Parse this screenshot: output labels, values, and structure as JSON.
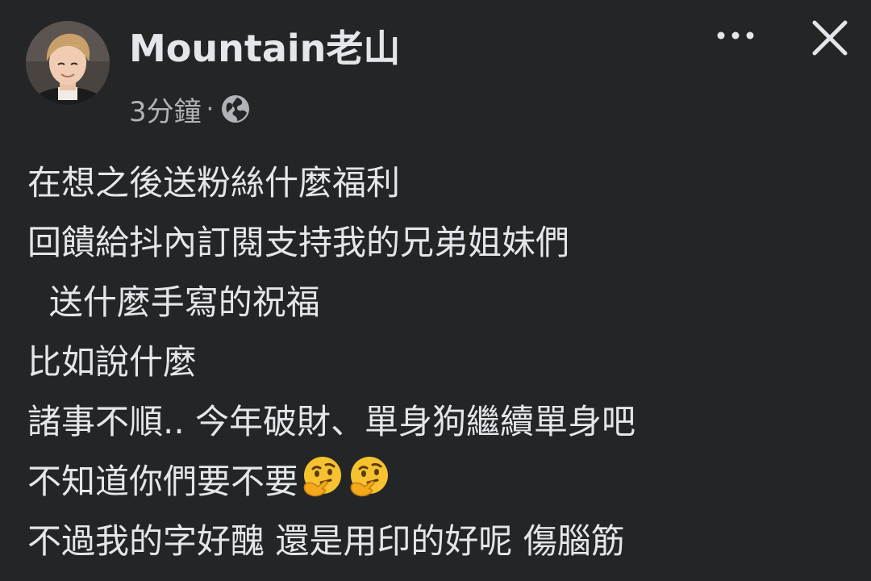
{
  "post": {
    "author_name": "Mountain老山",
    "timestamp": "3分鐘",
    "separator": "·",
    "privacy_icon": "globe-icon",
    "more_icon": "more-dots-icon",
    "close_icon": "close-icon",
    "lines": [
      "在想之後送粉絲什麼福利",
      "回饋給抖內訂閱支持我的兄弟姐妹們",
      "  送什麼手寫的祝福",
      "比如說什麼",
      "諸事不順.. 今年破財、單身狗繼續單身吧",
      "不知道你們要不要",
      "不過我的字好醜 還是用印的好呢 傷腦筋"
    ],
    "thinking_emoji": "thinking-face-emoji"
  },
  "colors": {
    "background": "#242526",
    "primary_text": "#e4e6eb",
    "secondary_text": "#b0b3b8"
  }
}
